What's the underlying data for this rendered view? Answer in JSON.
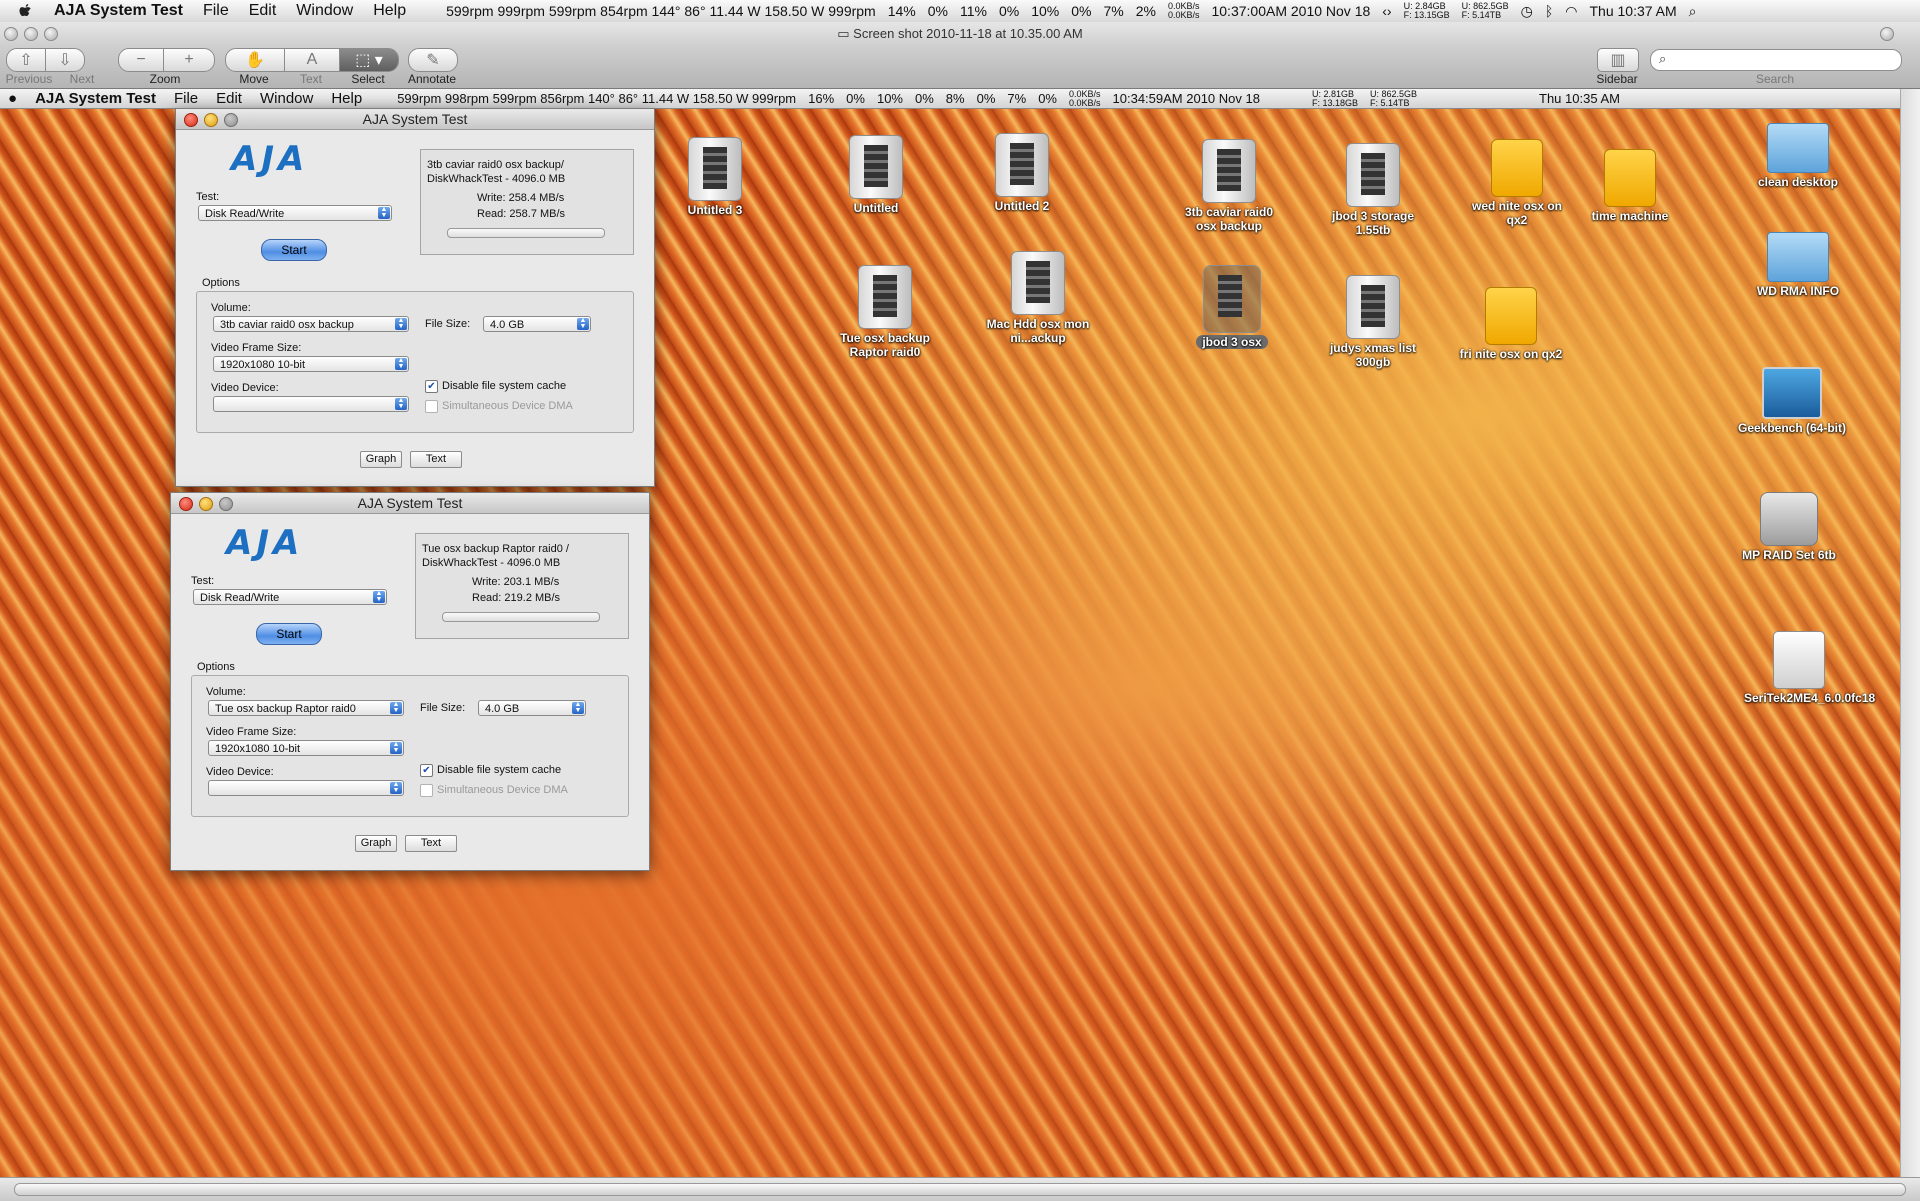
{
  "menubar": {
    "app": "AJA System Test",
    "items": [
      "File",
      "Edit",
      "Window",
      "Help"
    ],
    "status": "599rpm 999rpm 599rpm 854rpm 144° 86° 11.44 W 158.50 W 999rpm",
    "cpu": [
      "14%",
      "0%",
      "11%",
      "0%",
      "10%",
      "0%",
      "7%",
      "2%"
    ],
    "net_up": "0.0KB/s",
    "net_down": "0.0KB/s",
    "time": "10:37:00AM 2010 Nov 18",
    "disk_u": "U: 2.84GB",
    "disk_f": "F: 13.15GB",
    "disk2_u": "U: 862.5GB",
    "disk2_f": "F: 5.14TB",
    "clock": "Thu 10:37 AM"
  },
  "preview": {
    "title": "Screen shot 2010-11-18 at 10.35.00 AM",
    "toolbar": {
      "previous": "Previous",
      "next": "Next",
      "zoom": "Zoom",
      "move": "Move",
      "text": "Text",
      "select": "Select",
      "annotate": "Annotate",
      "sidebar": "Sidebar",
      "search": "Search"
    }
  },
  "inner_menubar": {
    "app": "AJA System Test",
    "items": [
      "File",
      "Edit",
      "Window",
      "Help"
    ],
    "status": "599rpm 998rpm 599rpm 856rpm 140° 86° 11.44 W 158.50 W 999rpm",
    "cpu": [
      "16%",
      "0%",
      "10%",
      "0%",
      "8%",
      "0%",
      "7%",
      "0%"
    ],
    "net_up": "0.0KB/s",
    "net_down": "0.0KB/s",
    "time": "10:34:59AM 2010 Nov 18",
    "disk_u": "U: 2.81GB",
    "disk_f": "F: 13.18GB",
    "disk2_u": "U: 862.5GB",
    "disk2_f": "F: 5.14TB",
    "clock": "Thu 10:35 AM"
  },
  "windows": [
    {
      "title": "AJA System Test",
      "logo": "AJA",
      "test_label": "Test:",
      "test_value": "Disk Read/Write",
      "start": "Start",
      "result_title": "3tb caviar raid0 osx backup/ DiskWhackTest - 4096.0 MB",
      "write": "Write: 258.4 MB/s",
      "read": "Read: 258.7 MB/s",
      "progress": 0,
      "options": "Options",
      "volume_label": "Volume:",
      "volume_value": "3tb caviar raid0 osx backup",
      "frame_label": "Video Frame Size:",
      "frame_value": "1920x1080 10-bit",
      "device_label": "Video Device:",
      "device_value": "",
      "filesize_label": "File Size:",
      "filesize_value": "4.0 GB",
      "cache_label": "Disable file system cache",
      "cache_checked": true,
      "dma_label": "Simultaneous Device DMA",
      "dma_checked": false,
      "graph": "Graph",
      "text": "Text"
    },
    {
      "title": "AJA System Test",
      "logo": "AJA",
      "test_label": "Test:",
      "test_value": "Disk Read/Write",
      "start": "Start",
      "result_title": "Tue osx backup Raptor raid0 / DiskWhackTest - 4096.0 MB",
      "write": "Write: 203.1 MB/s",
      "read": "Read: 219.2 MB/s",
      "progress": 0,
      "options": "Options",
      "volume_label": "Volume:",
      "volume_value": "Tue osx backup Raptor raid0",
      "frame_label": "Video Frame Size:",
      "frame_value": "1920x1080 10-bit",
      "device_label": "Video Device:",
      "device_value": "",
      "filesize_label": "File Size:",
      "filesize_value": "4.0 GB",
      "cache_label": "Disable file system cache",
      "cache_checked": true,
      "dma_label": "Simultaneous Device DMA",
      "dma_checked": false,
      "graph": "Graph",
      "text": "Text"
    }
  ],
  "desktop_icons": [
    {
      "name": "Untitled 3",
      "kind": "tower-drive-icon"
    },
    {
      "name": "Untitled",
      "kind": "tower-drive-icon"
    },
    {
      "name": "Untitled 2",
      "kind": "tower-drive-icon"
    },
    {
      "name": "3tb caviar raid0 osx backup",
      "kind": "tower-drive-icon"
    },
    {
      "name": "jbod 3 storage 1.55tb",
      "kind": "tower-drive-icon"
    },
    {
      "name": "wed nite osx on qx2",
      "kind": "firewire-drive-icon"
    },
    {
      "name": "time machine",
      "kind": "firewire-drive-icon"
    },
    {
      "name": "clean desktop",
      "kind": "folder-icon"
    },
    {
      "name": "WD RMA INFO",
      "kind": "folder-icon"
    },
    {
      "name": "Tue osx backup Raptor raid0",
      "kind": "tower-drive-icon"
    },
    {
      "name": "Mac Hdd osx mon ni...ackup",
      "kind": "tower-drive-icon"
    },
    {
      "name": "jbod 3 osx",
      "kind": "tower-drive-icon",
      "selected": true
    },
    {
      "name": "judys xmas list 300gb",
      "kind": "tower-drive-icon"
    },
    {
      "name": "fri nite osx on qx2",
      "kind": "firewire-drive-icon"
    },
    {
      "name": "Geekbench (64-bit)",
      "kind": "app-icon"
    },
    {
      "name": "MP RAID Set 6tb",
      "kind": "hard-disk-icon"
    },
    {
      "name": "SeriTek2ME4_6.0.0fc18",
      "kind": "external-disk-icon"
    }
  ]
}
